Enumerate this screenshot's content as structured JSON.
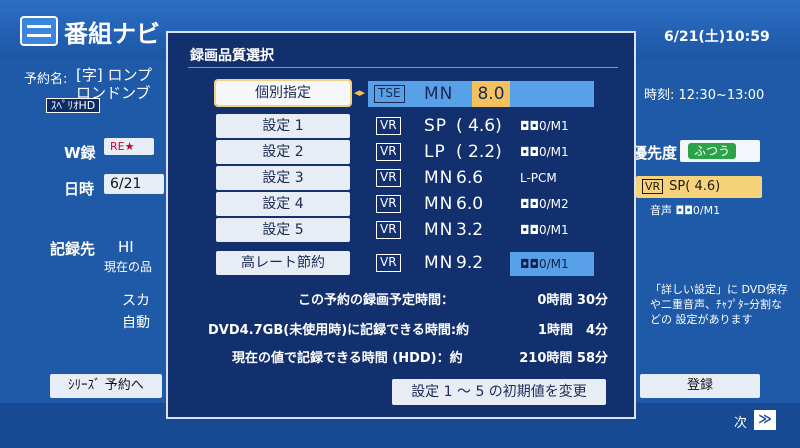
{
  "app": {
    "title": "番組ナビ",
    "datetime": "6/21(土)10:59"
  },
  "background": {
    "reservation_name_label": "予約名:",
    "reservation_name_line1": "[字] ロンプ",
    "reservation_name_line2": "ロンドンブ",
    "hd_badge": "ｽﾍﾟﾘｵHD",
    "time_right": "時刻: 12:30~13:00",
    "w_record_label": "W録",
    "w_record_icon": "RE★",
    "date_label": "日時",
    "date_value": "6/21",
    "priority_label": "優先度",
    "priority_value": "ふつう",
    "quality_value": "SP( 4.6)",
    "quality_vr": "VR",
    "audio_value": "音声 ◘◘0/M1",
    "dest_label": "記録先",
    "dest_value": "HI",
    "dest_note": "現在の品",
    "option1": "スカ",
    "option2": "自動",
    "side_note": "「詳しい設定」に DVD保存や二重音声、ﾁｬﾌﾟﾀｰ分割などの 設定があります",
    "series_button": "ｼﾘｰｽﾞ 予約へ",
    "register_button": "登録",
    "next_label": "次",
    "next_icon": "≫"
  },
  "modal": {
    "title": "録画品質選択",
    "rows": [
      {
        "label": "個別指定",
        "format": "TSE",
        "mode": "MN",
        "rate": "8.0",
        "audio": ""
      },
      {
        "label": "設定 1",
        "format": "VR",
        "mode": "SP",
        "rate": "( 4.6)",
        "audio": "◘◘0/M1"
      },
      {
        "label": "設定 2",
        "format": "VR",
        "mode": "LP",
        "rate": "( 2.2)",
        "audio": "◘◘0/M1"
      },
      {
        "label": "設定 3",
        "format": "VR",
        "mode": "MN",
        "rate": "6.6",
        "audio": "L-PCM"
      },
      {
        "label": "設定 4",
        "format": "VR",
        "mode": "MN",
        "rate": "6.0",
        "audio": "◘◘0/M2"
      },
      {
        "label": "設定 5",
        "format": "VR",
        "mode": "MN",
        "rate": "3.2",
        "audio": "◘◘0/M1"
      },
      {
        "label": "高レート節約",
        "format": "VR",
        "mode": "MN",
        "rate": "9.2",
        "audio": "◘◘0/M1"
      }
    ],
    "info": [
      {
        "label": "この予約の録画予定時間：",
        "value": "0時間 30分"
      },
      {
        "label": "DVD4.7GB(未使用時)に記録できる時間:約",
        "value": "1時間　4分"
      },
      {
        "label": "現在の値で記録できる時間 (HDD)：約",
        "value": "210時間 58分"
      }
    ],
    "change_default_button": "設定 1 ～ 5 の初期値を変更"
  }
}
